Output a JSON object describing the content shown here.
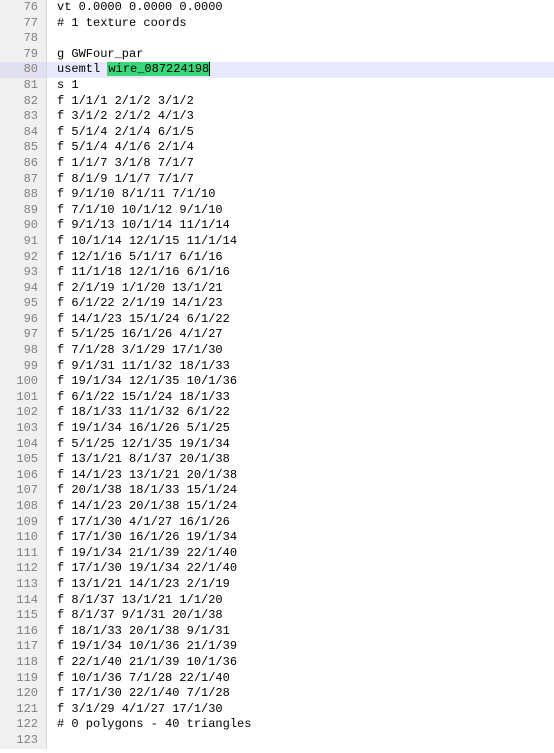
{
  "lines": [
    {
      "num": 76,
      "text": "vt 0.0000 0.0000 0.0000",
      "active": false,
      "highlight_token": null
    },
    {
      "num": 77,
      "text": "# 1 texture coords",
      "active": false,
      "highlight_token": null
    },
    {
      "num": 78,
      "text": "",
      "active": false,
      "highlight_token": null
    },
    {
      "num": 79,
      "text": "g GWFour_par",
      "active": false,
      "highlight_token": null
    },
    {
      "num": 80,
      "text": "usemtl wire_087224198",
      "active": true,
      "highlight_token": "wire_087224198"
    },
    {
      "num": 81,
      "text": "s 1",
      "active": false,
      "highlight_token": null
    },
    {
      "num": 82,
      "text": "f 1/1/1 2/1/2 3/1/2",
      "active": false,
      "highlight_token": null
    },
    {
      "num": 83,
      "text": "f 3/1/2 2/1/2 4/1/3",
      "active": false,
      "highlight_token": null
    },
    {
      "num": 84,
      "text": "f 5/1/4 2/1/4 6/1/5",
      "active": false,
      "highlight_token": null
    },
    {
      "num": 85,
      "text": "f 5/1/4 4/1/6 2/1/4",
      "active": false,
      "highlight_token": null
    },
    {
      "num": 86,
      "text": "f 1/1/7 3/1/8 7/1/7",
      "active": false,
      "highlight_token": null
    },
    {
      "num": 87,
      "text": "f 8/1/9 1/1/7 7/1/7",
      "active": false,
      "highlight_token": null
    },
    {
      "num": 88,
      "text": "f 9/1/10 8/1/11 7/1/10",
      "active": false,
      "highlight_token": null
    },
    {
      "num": 89,
      "text": "f 7/1/10 10/1/12 9/1/10",
      "active": false,
      "highlight_token": null
    },
    {
      "num": 90,
      "text": "f 9/1/13 10/1/14 11/1/14",
      "active": false,
      "highlight_token": null
    },
    {
      "num": 91,
      "text": "f 10/1/14 12/1/15 11/1/14",
      "active": false,
      "highlight_token": null
    },
    {
      "num": 92,
      "text": "f 12/1/16 5/1/17 6/1/16",
      "active": false,
      "highlight_token": null
    },
    {
      "num": 93,
      "text": "f 11/1/18 12/1/16 6/1/16",
      "active": false,
      "highlight_token": null
    },
    {
      "num": 94,
      "text": "f 2/1/19 1/1/20 13/1/21",
      "active": false,
      "highlight_token": null
    },
    {
      "num": 95,
      "text": "f 6/1/22 2/1/19 14/1/23",
      "active": false,
      "highlight_token": null
    },
    {
      "num": 96,
      "text": "f 14/1/23 15/1/24 6/1/22",
      "active": false,
      "highlight_token": null
    },
    {
      "num": 97,
      "text": "f 5/1/25 16/1/26 4/1/27",
      "active": false,
      "highlight_token": null
    },
    {
      "num": 98,
      "text": "f 7/1/28 3/1/29 17/1/30",
      "active": false,
      "highlight_token": null
    },
    {
      "num": 99,
      "text": "f 9/1/31 11/1/32 18/1/33",
      "active": false,
      "highlight_token": null
    },
    {
      "num": 100,
      "text": "f 19/1/34 12/1/35 10/1/36",
      "active": false,
      "highlight_token": null
    },
    {
      "num": 101,
      "text": "f 6/1/22 15/1/24 18/1/33",
      "active": false,
      "highlight_token": null
    },
    {
      "num": 102,
      "text": "f 18/1/33 11/1/32 6/1/22",
      "active": false,
      "highlight_token": null
    },
    {
      "num": 103,
      "text": "f 19/1/34 16/1/26 5/1/25",
      "active": false,
      "highlight_token": null
    },
    {
      "num": 104,
      "text": "f 5/1/25 12/1/35 19/1/34",
      "active": false,
      "highlight_token": null
    },
    {
      "num": 105,
      "text": "f 13/1/21 8/1/37 20/1/38",
      "active": false,
      "highlight_token": null
    },
    {
      "num": 106,
      "text": "f 14/1/23 13/1/21 20/1/38",
      "active": false,
      "highlight_token": null
    },
    {
      "num": 107,
      "text": "f 20/1/38 18/1/33 15/1/24",
      "active": false,
      "highlight_token": null
    },
    {
      "num": 108,
      "text": "f 14/1/23 20/1/38 15/1/24",
      "active": false,
      "highlight_token": null
    },
    {
      "num": 109,
      "text": "f 17/1/30 4/1/27 16/1/26",
      "active": false,
      "highlight_token": null
    },
    {
      "num": 110,
      "text": "f 17/1/30 16/1/26 19/1/34",
      "active": false,
      "highlight_token": null
    },
    {
      "num": 111,
      "text": "f 19/1/34 21/1/39 22/1/40",
      "active": false,
      "highlight_token": null
    },
    {
      "num": 112,
      "text": "f 17/1/30 19/1/34 22/1/40",
      "active": false,
      "highlight_token": null
    },
    {
      "num": 113,
      "text": "f 13/1/21 14/1/23 2/1/19",
      "active": false,
      "highlight_token": null
    },
    {
      "num": 114,
      "text": "f 8/1/37 13/1/21 1/1/20",
      "active": false,
      "highlight_token": null
    },
    {
      "num": 115,
      "text": "f 8/1/37 9/1/31 20/1/38",
      "active": false,
      "highlight_token": null
    },
    {
      "num": 116,
      "text": "f 18/1/33 20/1/38 9/1/31",
      "active": false,
      "highlight_token": null
    },
    {
      "num": 117,
      "text": "f 19/1/34 10/1/36 21/1/39",
      "active": false,
      "highlight_token": null
    },
    {
      "num": 118,
      "text": "f 22/1/40 21/1/39 10/1/36",
      "active": false,
      "highlight_token": null
    },
    {
      "num": 119,
      "text": "f 10/1/36 7/1/28 22/1/40",
      "active": false,
      "highlight_token": null
    },
    {
      "num": 120,
      "text": "f 17/1/30 22/1/40 7/1/28",
      "active": false,
      "highlight_token": null
    },
    {
      "num": 121,
      "text": "f 3/1/29 4/1/27 17/1/30",
      "active": false,
      "highlight_token": null
    },
    {
      "num": 122,
      "text": "# 0 polygons - 40 triangles",
      "active": false,
      "highlight_token": null
    },
    {
      "num": 123,
      "text": "",
      "active": false,
      "highlight_token": null
    }
  ]
}
